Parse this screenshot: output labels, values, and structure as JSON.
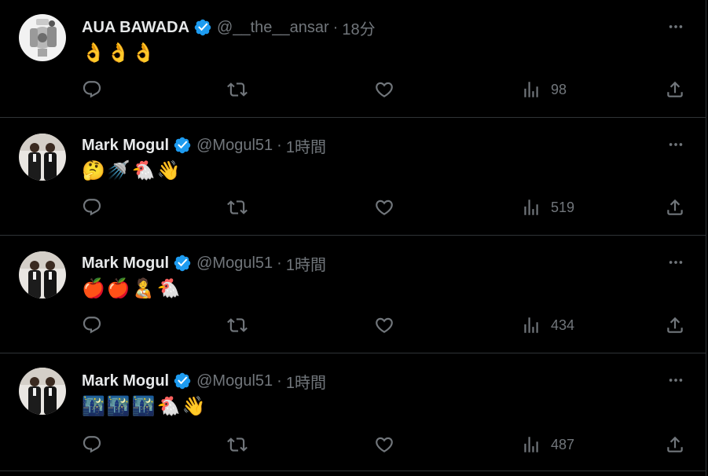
{
  "tweets": [
    {
      "name": "AUA BAWADA",
      "handle": "@__the__ansar",
      "separator": "·",
      "time": "18分",
      "content": "👌👌👌",
      "views": "98",
      "avatar_kind": "robot"
    },
    {
      "name": "Mark Mogul",
      "handle": "@Mogul51",
      "separator": "·",
      "time": "1時間",
      "content": "🤔🚿🐔👋",
      "views": "519",
      "avatar_kind": "people"
    },
    {
      "name": "Mark Mogul",
      "handle": "@Mogul51",
      "separator": "·",
      "time": "1時間",
      "content": "🍎🍎🧑‍🍼🐔",
      "views": "434",
      "avatar_kind": "people"
    },
    {
      "name": "Mark Mogul",
      "handle": "@Mogul51",
      "separator": "·",
      "time": "1時間",
      "content": "🌃🌃🌃🐔👋",
      "views": "487",
      "avatar_kind": "people"
    }
  ],
  "colors": {
    "background": "#000000",
    "text": "#e7e9ea",
    "muted": "#71767b",
    "verified": "#1d9bf0",
    "divider": "#2f3336"
  },
  "icons": [
    "reply-icon",
    "retweet-icon",
    "like-icon",
    "views-icon",
    "share-icon",
    "more-icon",
    "verified-badge-icon"
  ]
}
